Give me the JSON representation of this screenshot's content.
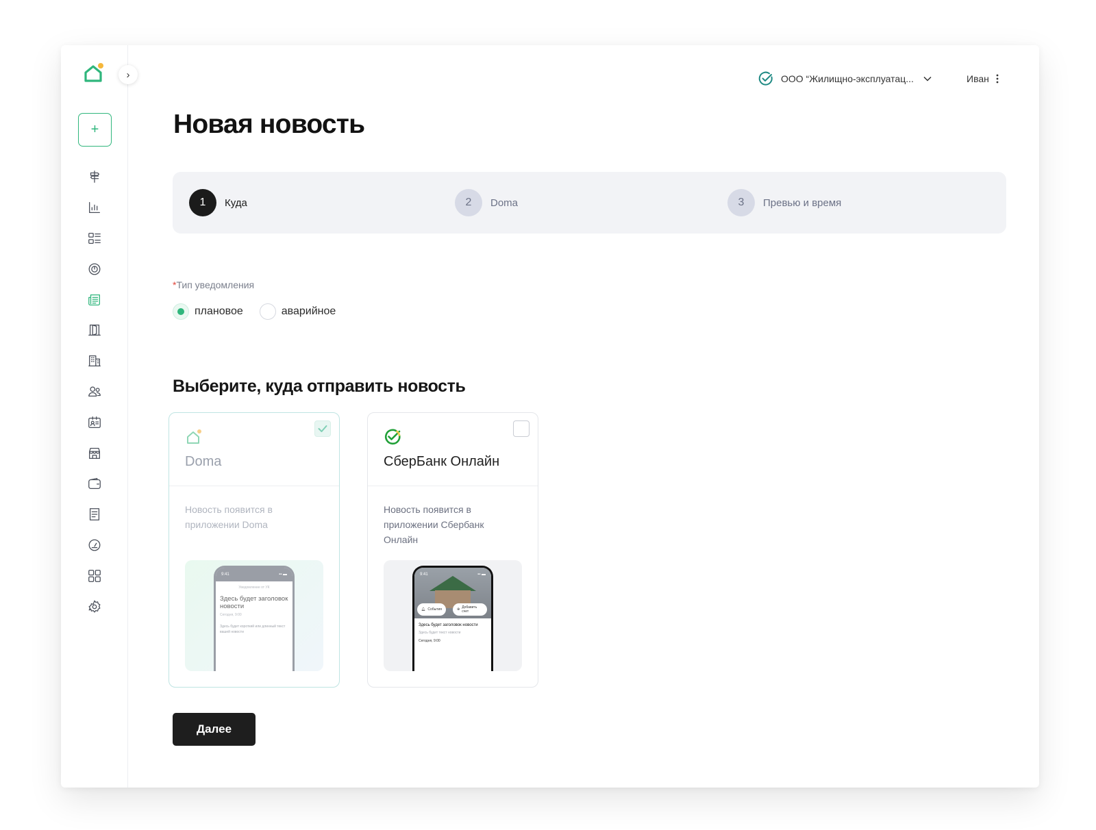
{
  "header": {
    "org_name": "ООО “Жилищно-эксплуатац...",
    "user_name": "Иван"
  },
  "page": {
    "title": "Новая новость"
  },
  "stepper": {
    "steps": [
      {
        "number": "1",
        "label": "Куда",
        "active": true
      },
      {
        "number": "2",
        "label": "Doma",
        "active": false
      },
      {
        "number": "3",
        "label": "Превью и время",
        "active": false
      }
    ]
  },
  "notification_type": {
    "required_mark": "*",
    "label": "Тип уведомления",
    "options": [
      {
        "label": "плановое",
        "checked": true
      },
      {
        "label": "аварийное",
        "checked": false
      }
    ]
  },
  "destinations": {
    "title": "Выберите, куда отправить новость",
    "cards": [
      {
        "title": "Doma",
        "description": "Новость появится в приложении Doma",
        "selected": true,
        "preview": {
          "time": "9:41",
          "sub": "Уведомление от УК",
          "headline": "Здесь будет заголовок новости",
          "date": "Сегодня, 9:00",
          "body": "Здесь будет короткий или длинный текст вашей новости"
        }
      },
      {
        "title": "СберБанк Онлайн",
        "description": "Новость появится в приложении Сбербанк Онлайн",
        "selected": false,
        "preview": {
          "time": "9:41",
          "pill_events": "События",
          "pill_add": "Добавить счет",
          "headline": "Здесь будет заголовок новости",
          "body": "Здесь будет текст новости",
          "date": "Сегодня, 9:00"
        }
      }
    ]
  },
  "actions": {
    "next_label": "Далее"
  },
  "sidebar": {
    "add_label": "+",
    "collapse_label": "›",
    "items": [
      {
        "icon": "signpost-icon"
      },
      {
        "icon": "bar-chart-icon"
      },
      {
        "icon": "list-icon"
      },
      {
        "icon": "meter-icon"
      },
      {
        "icon": "newspaper-icon",
        "active": true
      },
      {
        "icon": "door-icon"
      },
      {
        "icon": "building-icon"
      },
      {
        "icon": "users-icon"
      },
      {
        "icon": "id-card-icon"
      },
      {
        "icon": "store-icon"
      },
      {
        "icon": "wallet-icon"
      },
      {
        "icon": "document-icon"
      },
      {
        "icon": "gauge-icon"
      },
      {
        "icon": "grid-icon"
      },
      {
        "icon": "gear-icon"
      }
    ]
  },
  "colors": {
    "accent": "#2fb67c",
    "primary_button": "#1e1e1e",
    "stepper_bg": "#f2f3f6"
  }
}
